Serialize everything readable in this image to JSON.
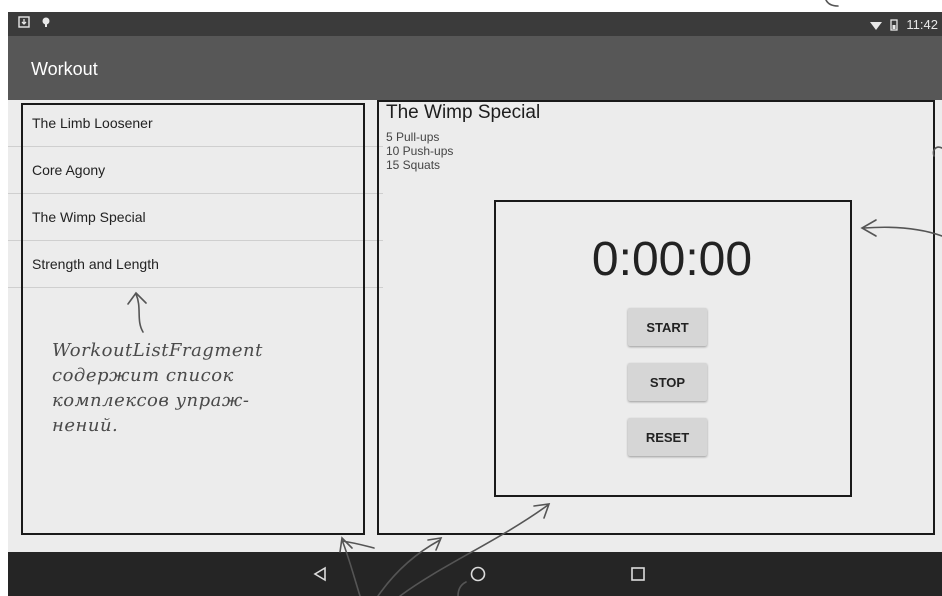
{
  "status_bar": {
    "time": "11:42",
    "left_icons": [
      "download-icon",
      "android-icon"
    ],
    "right_icons": [
      "wifi-icon",
      "battery-icon"
    ]
  },
  "app": {
    "title": "Workout"
  },
  "workout_list": {
    "items": [
      {
        "label": "The Limb Loosener"
      },
      {
        "label": "Core Agony"
      },
      {
        "label": "The Wimp Special"
      },
      {
        "label": "Strength and Length"
      }
    ]
  },
  "detail": {
    "title": "The Wimp Special",
    "steps": [
      "5 Pull-ups",
      "10 Push-ups",
      "15 Squats"
    ]
  },
  "stopwatch": {
    "time": "0:00:00",
    "start_label": "START",
    "stop_label": "STOP",
    "reset_label": "RESET"
  },
  "annotation": {
    "lines": [
      "WorkoutListFragment",
      "содержит список",
      "комплексов упраж-",
      "нений."
    ]
  },
  "nav_icons": [
    "back-icon",
    "home-icon",
    "recents-icon"
  ],
  "colors": {
    "status_bar": "#3b3b3b",
    "app_bar": "#575757",
    "background": "#ececec",
    "nav_bar": "#252525",
    "button": "#d6d6d6"
  }
}
